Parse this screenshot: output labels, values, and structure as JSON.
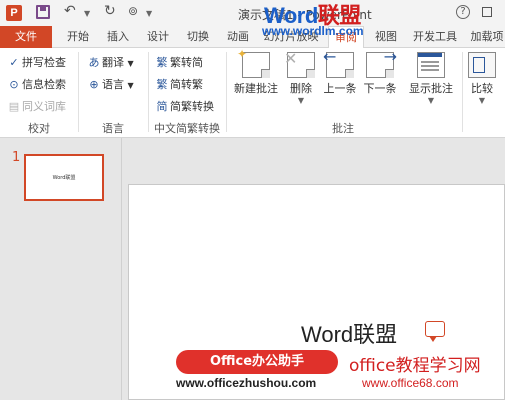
{
  "titlebar": {
    "app_logo": "P",
    "icons": [
      "powerpoint-logo-icon",
      "save-icon",
      "undo-icon",
      "redo-icon",
      "slideshow-icon"
    ],
    "title": "演示文稿1 - PowerPoint",
    "watermark_word": "Word",
    "watermark_cn": "联盟",
    "watermark_url": "www.wordlm.com",
    "help": "?"
  },
  "tabs": [
    {
      "label": "文件"
    },
    {
      "label": "开始"
    },
    {
      "label": "插入"
    },
    {
      "label": "设计"
    },
    {
      "label": "切换"
    },
    {
      "label": "动画"
    },
    {
      "label": "幻灯片放映"
    },
    {
      "label": "审阅"
    },
    {
      "label": "视图"
    },
    {
      "label": "开发工具"
    },
    {
      "label": "加载项"
    }
  ],
  "ribbon": {
    "proofing": {
      "items": [
        "拼写检查",
        "信息检索",
        "同义词库"
      ],
      "label": "校对"
    },
    "language": {
      "items": [
        "翻译",
        "语言"
      ],
      "label": "语言"
    },
    "chinese": {
      "items": [
        "繁转简",
        "简转繁",
        "简繁转换"
      ],
      "label": "中文简繁转换"
    },
    "comments": {
      "items": [
        "新建批注",
        "删除",
        "上一条",
        "下一条",
        "显示批注"
      ],
      "label": "批注"
    },
    "compare": {
      "items": [
        "比较"
      ]
    }
  },
  "thumbnails": [
    {
      "number": "1",
      "text": "Word联盟"
    }
  ],
  "slide": {
    "title": "Word联盟"
  },
  "watermark": {
    "left_banner": "Office办公助手",
    "left_url": "www.officezhushou.com",
    "right_title": "office教程学习网",
    "right_url": "www.office68.com"
  },
  "colors": {
    "accent": "#d24726",
    "ribbon_icon": "#2b579a"
  }
}
